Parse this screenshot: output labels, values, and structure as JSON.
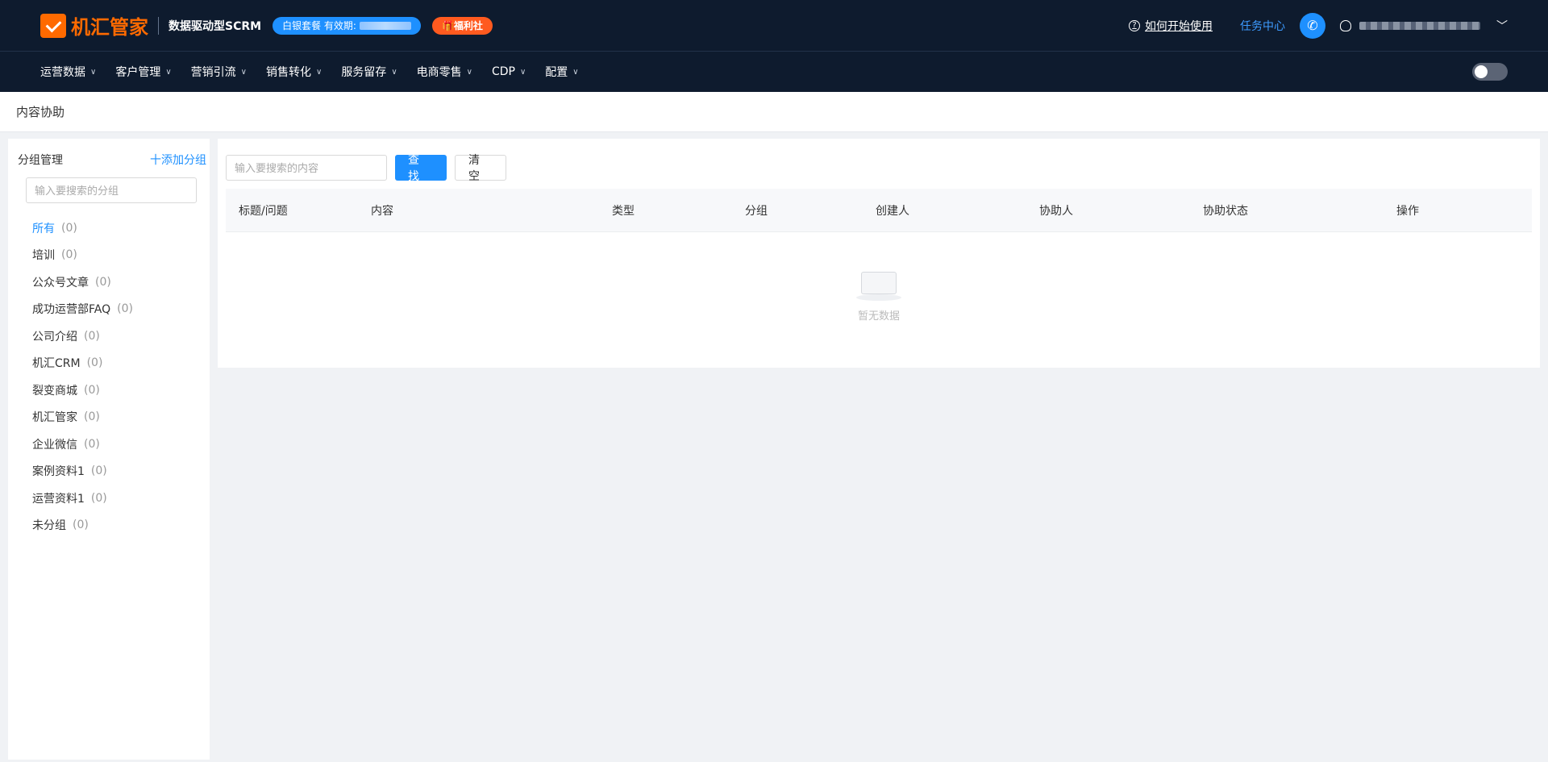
{
  "header": {
    "brand": "机汇管家",
    "subtitle": "数据驱动型SCRM",
    "plan_badge": "白银套餐 有效期:",
    "welfare_badge": "福利社",
    "help_label": "如何开始使用",
    "task_center": "任务中心",
    "help_icon": "question-circle-icon",
    "phone_icon": "phone-icon",
    "user_icon": "user-icon"
  },
  "nav": {
    "items": [
      "运营数据",
      "客户管理",
      "营销引流",
      "销售转化",
      "服务留存",
      "电商零售",
      "CDP",
      "配置"
    ]
  },
  "page": {
    "title": "内容协助"
  },
  "sidebar": {
    "title": "分组管理",
    "add_label": "十添加分组",
    "search_placeholder": "输入要搜索的分组",
    "groups": [
      {
        "label": "所有",
        "count": "(0)"
      },
      {
        "label": "培训",
        "count": "(0)"
      },
      {
        "label": "公众号文章",
        "count": "(0)"
      },
      {
        "label": "成功运营部FAQ",
        "count": "(0)"
      },
      {
        "label": "公司介绍",
        "count": "(0)"
      },
      {
        "label": "机汇CRM",
        "count": "(0)"
      },
      {
        "label": "裂变商城",
        "count": "(0)"
      },
      {
        "label": "机汇管家",
        "count": "(0)"
      },
      {
        "label": "企业微信",
        "count": "(0)"
      },
      {
        "label": "案例资料1",
        "count": "(0)"
      },
      {
        "label": "运营资料1",
        "count": "(0)"
      },
      {
        "label": "未分组",
        "count": "(0)"
      }
    ]
  },
  "toolbar": {
    "search_placeholder": "输入要搜索的内容",
    "search_button": "查找",
    "clear_button": "清空"
  },
  "table": {
    "columns": [
      "标题/问题",
      "内容",
      "类型",
      "分组",
      "创建人",
      "协助人",
      "协助状态",
      "操作"
    ],
    "empty_text": "暂无数据"
  }
}
